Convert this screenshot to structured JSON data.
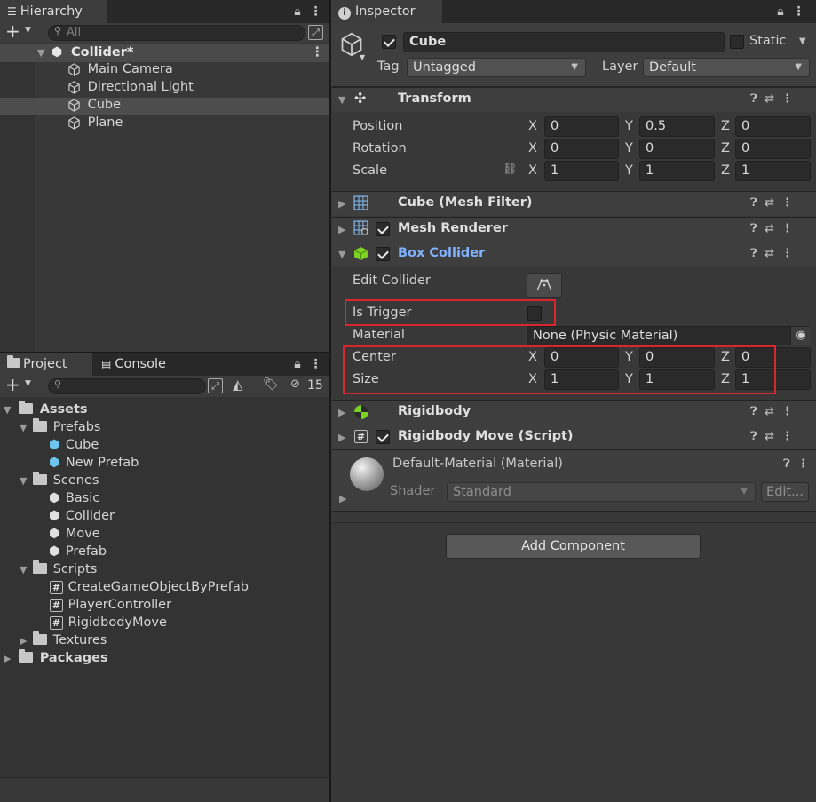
{
  "hierarchy": {
    "tab_label": "Hierarchy",
    "search_placeholder": "All",
    "scene_name": "Collider*",
    "items": [
      "Main Camera",
      "Directional Light",
      "Cube",
      "Plane"
    ],
    "selected": "Cube"
  },
  "project": {
    "tab_label": "Project",
    "console_label": "Console",
    "hidden_count": "15",
    "tree": {
      "assets": "Assets",
      "prefabs": "Prefabs",
      "prefab_items": [
        "Cube",
        "New Prefab"
      ],
      "scenes": "Scenes",
      "scene_items": [
        "Basic",
        "Collider",
        "Move",
        "Prefab"
      ],
      "scripts": "Scripts",
      "script_items": [
        "CreateGameObjectByPrefab",
        "PlayerController",
        "RigidbodyMove"
      ],
      "textures": "Textures",
      "packages": "Packages"
    }
  },
  "inspector": {
    "tab_label": "Inspector",
    "object_name": "Cube",
    "static_label": "Static",
    "tag_label": "Tag",
    "tag_value": "Untagged",
    "layer_label": "Layer",
    "layer_value": "Default",
    "transform": {
      "title": "Transform",
      "position_label": "Position",
      "rotation_label": "Rotation",
      "scale_label": "Scale",
      "position": [
        "0",
        "0.5",
        "0"
      ],
      "rotation": [
        "0",
        "0",
        "0"
      ],
      "scale": [
        "1",
        "1",
        "1"
      ]
    },
    "axes": [
      "X",
      "Y",
      "Z"
    ],
    "mesh_filter_title": "Cube (Mesh Filter)",
    "mesh_renderer_title": "Mesh Renderer",
    "box_collider": {
      "title": "Box Collider",
      "edit_collider_label": "Edit Collider",
      "is_trigger_label": "Is Trigger",
      "material_label": "Material",
      "material_value": "None (Physic Material)",
      "center_label": "Center",
      "size_label": "Size",
      "center": [
        "0",
        "0",
        "0"
      ],
      "size": [
        "1",
        "1",
        "1"
      ]
    },
    "rigidbody_title": "Rigidbody",
    "rigidbody_move_title": "Rigidbody Move (Script)",
    "material": {
      "name": "Default-Material (Material)",
      "shader_label": "Shader",
      "shader_value": "Standard",
      "edit_label": "Edit..."
    },
    "add_component_label": "Add Component"
  },
  "colors": {
    "highlight_box": "#d9262c",
    "box_collider_title": "#80b2ff",
    "selection": "#4d4d4d"
  }
}
